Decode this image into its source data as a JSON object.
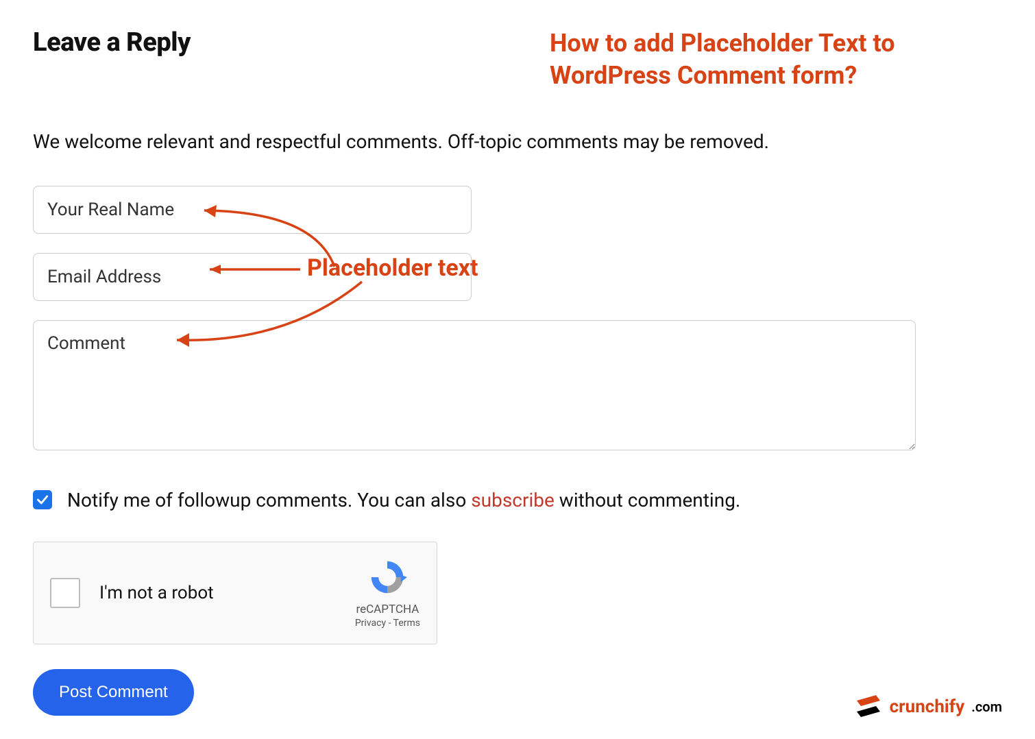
{
  "header": {
    "title": "Leave a Reply",
    "annotation_title": "How to add Placeholder Text to WordPress Comment form?"
  },
  "intro": "We welcome relevant and respectful comments. Off-topic comments may be removed.",
  "form": {
    "name_placeholder": "Your Real Name",
    "email_placeholder": "Email Address",
    "comment_placeholder": "Comment"
  },
  "annotation_label": "Placeholder text",
  "notify": {
    "text_before": "Notify me of followup comments. You can also ",
    "link_text": "subscribe",
    "text_after": " without commenting.",
    "checked": true
  },
  "recaptcha": {
    "label": "I'm not a robot",
    "brand": "reCAPTCHA",
    "privacy": "Privacy",
    "terms": "Terms"
  },
  "submit_label": "Post Comment",
  "brand": {
    "name": "crunchify",
    "tld": ".com"
  },
  "colors": {
    "accent_red": "#d84315",
    "button_blue": "#2563eb",
    "checkbox_blue": "#1a73e8"
  }
}
